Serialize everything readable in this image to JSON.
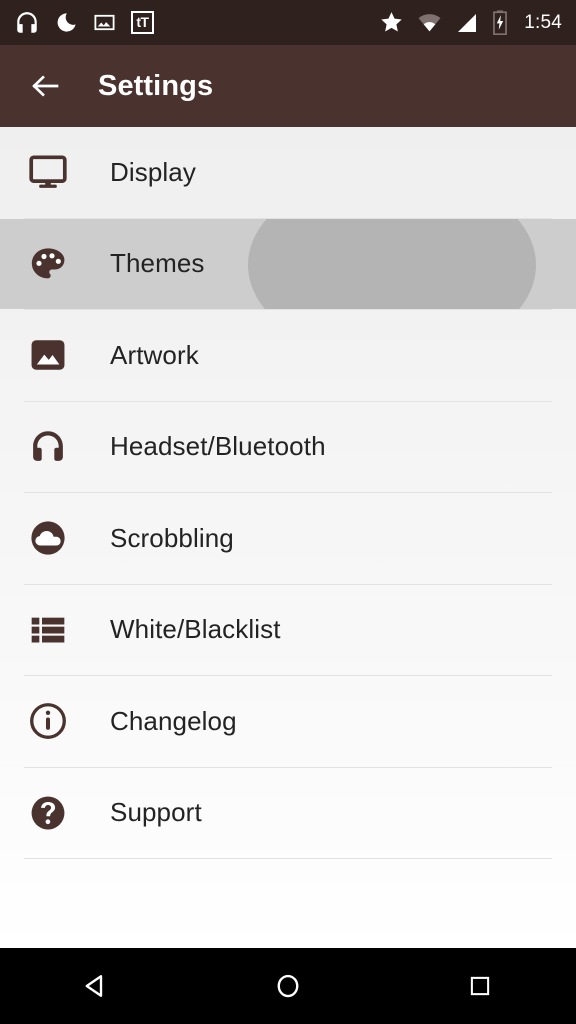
{
  "status_bar": {
    "background": "#2e211e",
    "time": "1:54",
    "left_icons": [
      {
        "name": "headphones-icon"
      },
      {
        "name": "do-not-disturb-moon-icon"
      },
      {
        "name": "image-icon"
      },
      {
        "name": "text-tt-icon",
        "label": "tT"
      }
    ],
    "right_icons": [
      {
        "name": "star-icon"
      },
      {
        "name": "wifi-icon"
      },
      {
        "name": "cellular-signal-icon"
      },
      {
        "name": "battery-charging-icon"
      }
    ]
  },
  "toolbar": {
    "background": "#4a332e",
    "back_icon": "back-arrow-icon",
    "title": "Settings"
  },
  "settings": {
    "accent_color": "#4a332e",
    "pressed_row_index": 1,
    "items": [
      {
        "label": "Display",
        "icon": "monitor-icon"
      },
      {
        "label": "Themes",
        "icon": "palette-icon"
      },
      {
        "label": "Artwork",
        "icon": "picture-icon"
      },
      {
        "label": "Headset/Bluetooth",
        "icon": "headphones-icon"
      },
      {
        "label": "Scrobbling",
        "icon": "cloud-icon"
      },
      {
        "label": "White/Blacklist",
        "icon": "list-icon"
      },
      {
        "label": "Changelog",
        "icon": "info-circle-icon"
      },
      {
        "label": "Support",
        "icon": "question-circle-icon"
      }
    ]
  },
  "nav_bar": {
    "background": "#000000",
    "buttons": [
      {
        "name": "back-nav-button"
      },
      {
        "name": "home-nav-button"
      },
      {
        "name": "recents-nav-button"
      }
    ]
  }
}
